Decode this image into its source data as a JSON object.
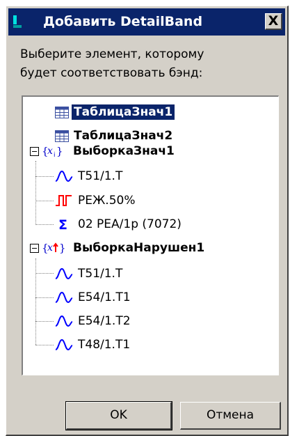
{
  "dialog": {
    "title": "Добавить DetailBand",
    "close_label": "X",
    "prompt": "Выберите элемент, которому\nбудет соответствовать бэнд:"
  },
  "tree": {
    "items": [
      {
        "label": "ТаблицаЗнач1",
        "icon": "table-icon",
        "selected": true
      },
      {
        "label": "ТаблицаЗнач2",
        "icon": "table-icon"
      },
      {
        "label": "ВыборкаЗнач1",
        "icon": "selection-icon",
        "expanded": true
      },
      {
        "label": "T51/1.T",
        "icon": "analog-signal-icon"
      },
      {
        "label": "РЕЖ.50%",
        "icon": "discrete-signal-icon"
      },
      {
        "label": "02 PEA/1p (7072)",
        "icon": "sum-icon"
      },
      {
        "label": "ВыборкаНарушен1",
        "icon": "violations-selection-icon",
        "expanded": true
      },
      {
        "label": "T51/1.T",
        "icon": "analog-signal-icon"
      },
      {
        "label": "E54/1.T1",
        "icon": "analog-signal-icon"
      },
      {
        "label": "E54/1.T2",
        "icon": "analog-signal-icon"
      },
      {
        "label": "T48/1.T1",
        "icon": "analog-signal-icon"
      }
    ]
  },
  "buttons": {
    "ok": "OK",
    "cancel": "Отмена"
  },
  "colors": {
    "titlebar": "#0a246a",
    "face": "#d4d0c8",
    "selection": "#0a246a",
    "signal_blue": "#0000ff",
    "signal_red": "#ff0000"
  }
}
